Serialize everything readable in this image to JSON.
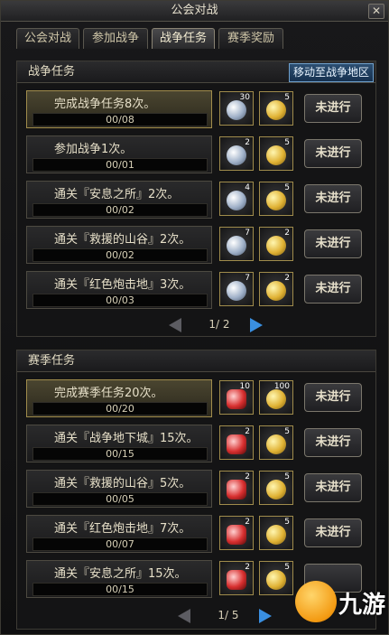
{
  "window": {
    "title": "公会对战",
    "close_label": "✕"
  },
  "tabs": [
    {
      "label": "公会对战"
    },
    {
      "label": "参加战争"
    },
    {
      "label": "战争任务"
    },
    {
      "label": "赛季奖励"
    }
  ],
  "war_tasks": {
    "header": "战争任务",
    "move_button": "移动至战争地区",
    "rows": [
      {
        "name": "完成战争任务8次。",
        "progress": "00/08",
        "reward1_count": "30",
        "reward2_count": "5",
        "status": "未进行"
      },
      {
        "name": "参加战争1次。",
        "progress": "00/01",
        "reward1_count": "2",
        "reward2_count": "5",
        "status": "未进行"
      },
      {
        "name": "通关『安息之所』2次。",
        "progress": "00/02",
        "reward1_count": "4",
        "reward2_count": "5",
        "status": "未进行"
      },
      {
        "name": "通关『救援的山谷』2次。",
        "progress": "00/02",
        "reward1_count": "7",
        "reward2_count": "2",
        "status": "未进行"
      },
      {
        "name": "通关『红色炮击地』3次。",
        "progress": "00/03",
        "reward1_count": "7",
        "reward2_count": "2",
        "status": "未进行"
      }
    ],
    "pager": "1/ 2"
  },
  "season_tasks": {
    "header": "赛季任务",
    "rows": [
      {
        "name": "完成赛季任务20次。",
        "progress": "00/20",
        "reward1_count": "10",
        "reward2_count": "100",
        "status": "未进行"
      },
      {
        "name": "通关『战争地下城』15次。",
        "progress": "00/15",
        "reward1_count": "2",
        "reward2_count": "5",
        "status": "未进行"
      },
      {
        "name": "通关『救援的山谷』5次。",
        "progress": "00/05",
        "reward1_count": "2",
        "reward2_count": "5",
        "status": "未进行"
      },
      {
        "name": "通关『红色炮击地』7次。",
        "progress": "00/07",
        "reward1_count": "2",
        "reward2_count": "5",
        "status": "未进行"
      },
      {
        "name": "通关『安息之所』15次。",
        "progress": "00/15",
        "reward1_count": "2",
        "reward2_count": "5",
        "status": ""
      }
    ],
    "pager": "1/ 5"
  },
  "watermark": {
    "text": "九游"
  }
}
